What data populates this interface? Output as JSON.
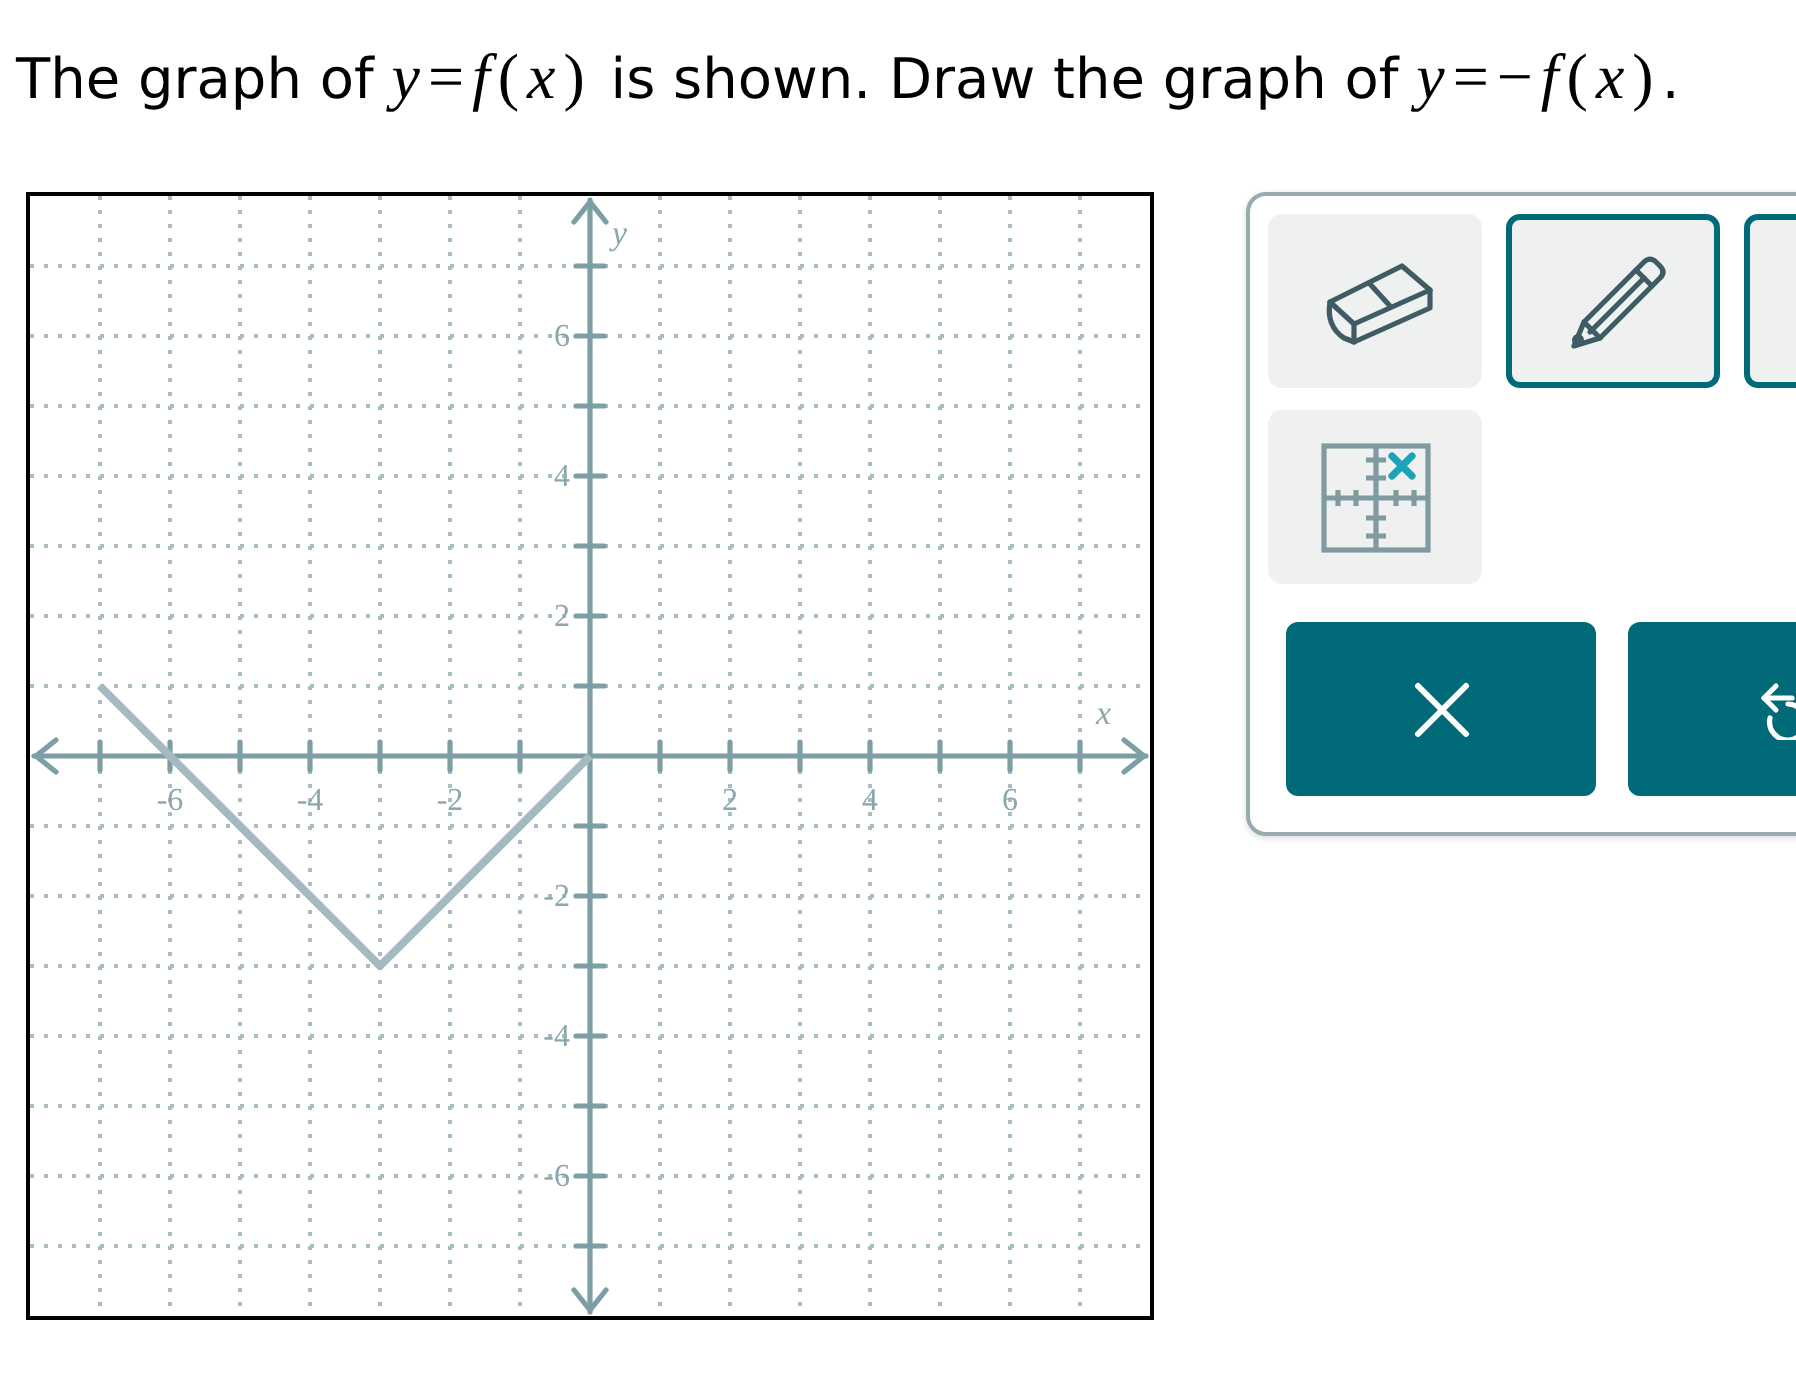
{
  "prompt": [
    {
      "kind": "text",
      "text": "The graph of "
    },
    {
      "kind": "math",
      "text": "*y*=*f*(*x*)"
    },
    {
      "kind": "text",
      "text": " is shown. Draw the graph of "
    },
    {
      "kind": "math",
      "text": "*y*=−*f*(*x*)"
    },
    {
      "kind": "text",
      "text": "."
    }
  ],
  "graph": {
    "chart_data": {
      "type": "line",
      "grid": true,
      "xlabel": "x",
      "ylabel": "y",
      "x": [
        -7,
        -3,
        0
      ],
      "values": [
        1,
        -3,
        0
      ],
      "xlim": [
        -8,
        8
      ],
      "ylim": [
        -8,
        8
      ],
      "xticks": [
        -6,
        -4,
        -2,
        2,
        4,
        6
      ],
      "yticks": [
        -6,
        -4,
        -2,
        2,
        4,
        6
      ]
    }
  },
  "tools": [
    {
      "kind": "eraser",
      "selected": false
    },
    {
      "kind": "pencil",
      "selected": true
    },
    {
      "selected": true
    },
    {
      "kind": "point",
      "selected": false
    }
  ],
  "actions": [
    {
      "kind": "clear"
    },
    {
      "kind": "undo"
    }
  ]
}
